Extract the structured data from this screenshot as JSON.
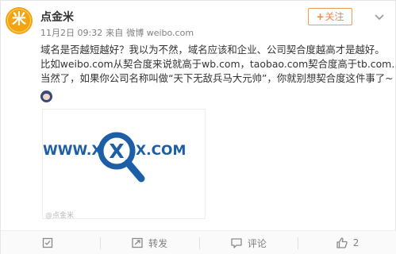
{
  "post": {
    "author": "点金米",
    "avatar_glyph": "米",
    "time": "11月2日 09:32",
    "source_prefix": "来自",
    "source": "微博 weibo.com",
    "follow_label": "关注",
    "text_lines": [
      "域名是否越短越好？我以为不然，域名应该和企业、公司契合度越高才是越好。",
      "比如weibo.com从契合度来说就高于wb.com，taobao.com契合度高于tb.com……",
      "当然了，如果你公司名称叫做“天下无敌兵马大元帅”，你就别想契合度这件事了~"
    ],
    "image_text_left": "WWW.X",
    "image_text_center": "X",
    "image_text_right": "X.COM",
    "watermark": "@点金米",
    "brand_color": "#ff8140",
    "image_color": "#1d5fa6"
  },
  "actions": {
    "favorite_label": "",
    "repost_label": "转发",
    "comment_label": "评论",
    "like_count": "2"
  }
}
